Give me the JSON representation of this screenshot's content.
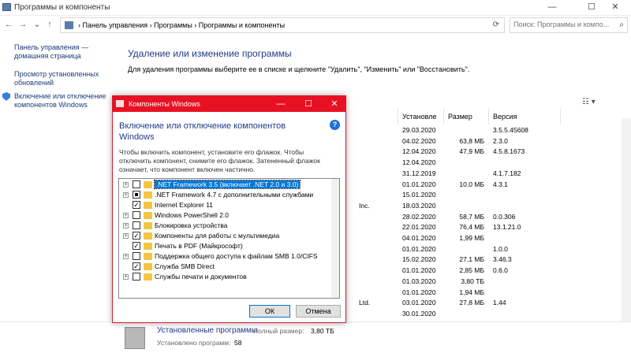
{
  "window": {
    "title": "Программы и компоненты",
    "min_icon": "—",
    "max_icon": "☐",
    "close_icon": "✕"
  },
  "address": {
    "back_icon": "←",
    "forward_icon": "→",
    "recent_icon": "⌄",
    "up_icon": "↑",
    "path": "›  Панель управления  ›  Программы  ›  Программы и компоненты",
    "search_placeholder": "Поиск: Программы и компо...",
    "refresh_icon": "⟳",
    "search_icon": "⌕"
  },
  "left_pane": {
    "home_link": "Панель управления — домашняя страница",
    "updates_link": "Просмотр установленных обновлений",
    "features_link": "Включение или отключение компонентов Windows"
  },
  "main": {
    "heading": "Удаление или изменение программы",
    "description": "Для удаления программы выберите ее в списке и щелкните \"Удалить\", \"Изменить\" или \"Восстановить\".",
    "view_icon": "☷ ▾",
    "columns": [
      "Установле",
      "Размер",
      "Версия"
    ],
    "rows": [
      {
        "pub": "",
        "date": "29.03.2020",
        "size": "",
        "ver": "3.5.5.45608"
      },
      {
        "pub": "",
        "date": "04.02.2020",
        "size": "63,8 МБ",
        "ver": "2.3.0"
      },
      {
        "pub": "",
        "date": "12.04.2020",
        "size": "47,9 МБ",
        "ver": "4.5.8.1673"
      },
      {
        "pub": "",
        "date": "12.04.2020",
        "size": "",
        "ver": ""
      },
      {
        "pub": "",
        "date": "31.12.2019",
        "size": "",
        "ver": "4.1.7.182"
      },
      {
        "pub": "",
        "date": "01.01.2020",
        "size": "10,0 МБ",
        "ver": "4.3.1"
      },
      {
        "pub": "",
        "date": "15.01.2020",
        "size": "",
        "ver": ""
      },
      {
        "pub": "Inc.",
        "date": "18.03.2020",
        "size": "",
        "ver": ""
      },
      {
        "pub": "",
        "date": "28.02.2020",
        "size": "58,7 МБ",
        "ver": "0.0.306"
      },
      {
        "pub": "",
        "date": "22.01.2020",
        "size": "76,4 МБ",
        "ver": "13.1.21.0"
      },
      {
        "pub": "",
        "date": "04.01.2020",
        "size": "1,99 МБ",
        "ver": ""
      },
      {
        "pub": "",
        "date": "01.01.2020",
        "size": "",
        "ver": "1.0.0"
      },
      {
        "pub": "",
        "date": "15.02.2020",
        "size": "27,1 МБ",
        "ver": "3.46.3"
      },
      {
        "pub": "",
        "date": "01.01.2020",
        "size": "2,85 МБ",
        "ver": "0.6.0"
      },
      {
        "pub": "",
        "date": "01.03.2020",
        "size": "3,80 ТБ",
        "ver": ""
      },
      {
        "pub": "",
        "date": "01.01.2020",
        "size": "1,94 МБ",
        "ver": ""
      },
      {
        "pub": "Ltd.",
        "date": "03.01.2020",
        "size": "27,8 МБ",
        "ver": "1.44"
      },
      {
        "pub": "",
        "date": "30.01.2020",
        "size": "",
        "ver": ""
      }
    ]
  },
  "status": {
    "label": "Установленные программы",
    "size_label": "Полный размер:",
    "size_value": "3,80 ТБ",
    "count_label": "Установлено программ:",
    "count_value": "58"
  },
  "dialog": {
    "title": "Компоненты Windows",
    "min_icon": "—",
    "max_icon": "☐",
    "close_icon": "✕",
    "heading": "Включение или отключение компонентов Windows",
    "help_icon": "?",
    "description": "Чтобы включить компонент, установите его флажок. Чтобы отключить компонент, снимите его флажок. Затененный флажок означает, что компонент включен частично.",
    "features": [
      {
        "label": ".NET Framework 3.5 (включает .NET 2.0 и 3.0)",
        "expand": "+",
        "state": "unchecked",
        "selected": true
      },
      {
        "label": ".NET Framework 4.7 с дополнительными службами",
        "expand": "+",
        "state": "partial",
        "selected": false
      },
      {
        "label": "Internet Explorer 11",
        "expand": "",
        "state": "checked",
        "selected": false
      },
      {
        "label": "Windows PowerShell 2.0",
        "expand": "+",
        "state": "unchecked",
        "selected": false
      },
      {
        "label": "Блокировка устройства",
        "expand": "+",
        "state": "unchecked",
        "selected": false
      },
      {
        "label": "Компоненты для работы с мультимедиа",
        "expand": "+",
        "state": "checked",
        "selected": false
      },
      {
        "label": "Печать в PDF (Майкрософт)",
        "expand": "",
        "state": "checked",
        "selected": false
      },
      {
        "label": "Поддержка общего доступа к файлам SMB 1.0/CIFS",
        "expand": "+",
        "state": "unchecked",
        "selected": false
      },
      {
        "label": "Служба SMB Direct",
        "expand": "",
        "state": "checked",
        "selected": false
      },
      {
        "label": "Службы печати и документов",
        "expand": "+",
        "state": "unchecked",
        "selected": false
      }
    ],
    "ok_label": "ОК",
    "cancel_label": "Отмена"
  },
  "colors": {
    "accent": "#e81123",
    "link": "#1e3a8a",
    "selection": "#0078d7"
  }
}
